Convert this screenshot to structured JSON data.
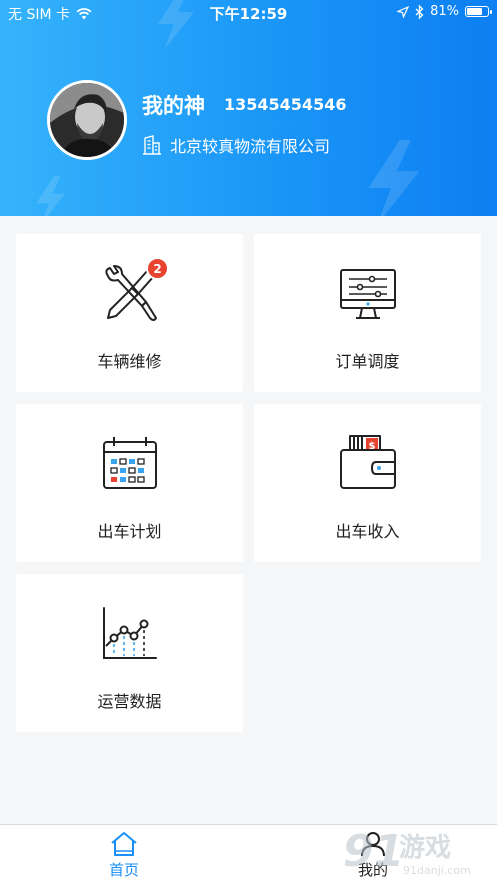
{
  "status_bar": {
    "carrier": "无 SIM 卡",
    "time": "下午12:59",
    "battery_percent": "81%",
    "battery_level": 0.81
  },
  "profile": {
    "name": "我的神",
    "phone": "13545454546",
    "company": "北京较真物流有限公司",
    "company_icon": "building-icon"
  },
  "menu": [
    {
      "label": "车辆维修",
      "icon": "wrench-screwdriver-icon",
      "badge": "2"
    },
    {
      "label": "订单调度",
      "icon": "monitor-sliders-icon"
    },
    {
      "label": "出车计划",
      "icon": "calendar-icon"
    },
    {
      "label": "出车收入",
      "icon": "wallet-icon"
    },
    {
      "label": "运营数据",
      "icon": "line-chart-icon"
    }
  ],
  "tabbar": {
    "items": [
      {
        "label": "首页",
        "icon": "home-icon",
        "active": true
      },
      {
        "label": "我的",
        "icon": "user-icon",
        "active": false
      }
    ]
  },
  "watermark": {
    "brand": "91游戏",
    "site": "91danji.com"
  },
  "colors": {
    "accent": "#1a8ff5",
    "badge": "#e8432f",
    "header_start": "#35b3fb",
    "header_end": "#0d7ff2"
  }
}
